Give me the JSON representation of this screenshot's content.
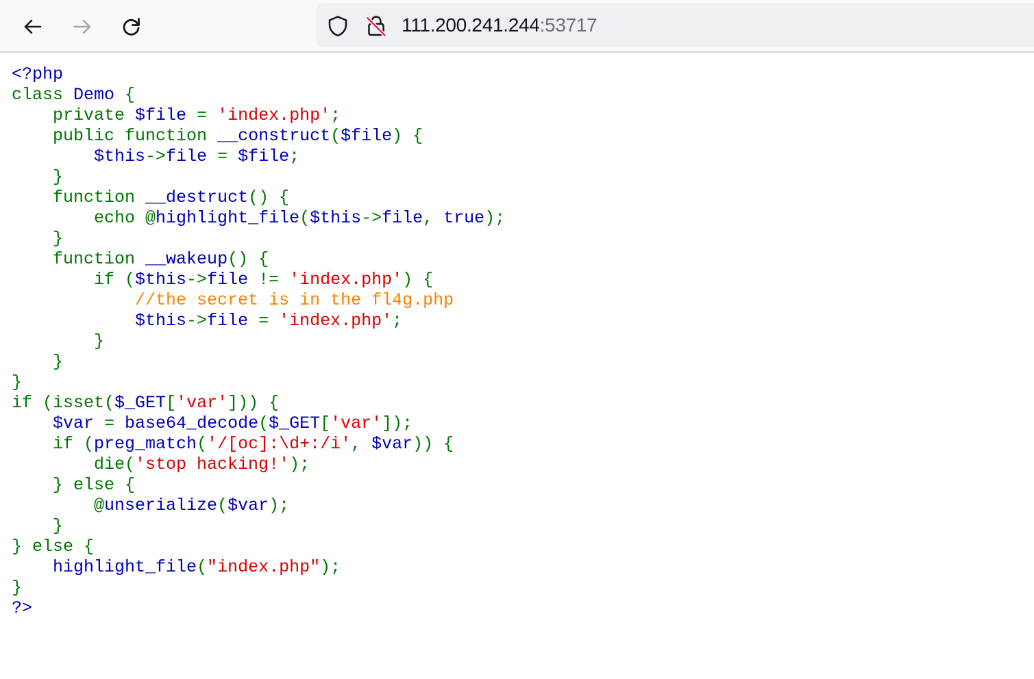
{
  "browser": {
    "back_label": "Back",
    "forward_label": "Forward",
    "reload_label": "Reload",
    "url_host": "111.200.241.244",
    "url_port": ":53717",
    "icons": [
      "arrow-left-icon",
      "arrow-right-icon",
      "reload-icon",
      "shield-icon",
      "insecure-lock-icon"
    ]
  },
  "colors": {
    "html": "#000000",
    "default": "#0000BB",
    "keyword": "#007700",
    "string": "#DD0000",
    "comment": "#FF8000"
  },
  "code_lines": [
    [
      {
        "t": "&lt;?php",
        "c": "default"
      }
    ],
    [
      {
        "t": "class ",
        "c": "keyword"
      },
      {
        "t": "Demo ",
        "c": "default"
      },
      {
        "t": "{",
        "c": "keyword"
      }
    ],
    [
      {
        "t": "    private ",
        "c": "keyword"
      },
      {
        "t": "$file ",
        "c": "default"
      },
      {
        "t": "= ",
        "c": "keyword"
      },
      {
        "t": "'index.php'",
        "c": "string"
      },
      {
        "t": ";",
        "c": "keyword"
      }
    ],
    [
      {
        "t": "    public function ",
        "c": "keyword"
      },
      {
        "t": "__construct",
        "c": "default"
      },
      {
        "t": "(",
        "c": "keyword"
      },
      {
        "t": "$file",
        "c": "default"
      },
      {
        "t": ") {",
        "c": "keyword"
      }
    ],
    [
      {
        "t": "        ",
        "c": "keyword"
      },
      {
        "t": "$this",
        "c": "default"
      },
      {
        "t": "-&gt;",
        "c": "keyword"
      },
      {
        "t": "file ",
        "c": "default"
      },
      {
        "t": "= ",
        "c": "keyword"
      },
      {
        "t": "$file",
        "c": "default"
      },
      {
        "t": ";",
        "c": "keyword"
      }
    ],
    [
      {
        "t": "    }",
        "c": "keyword"
      }
    ],
    [
      {
        "t": "    function ",
        "c": "keyword"
      },
      {
        "t": "__destruct",
        "c": "default"
      },
      {
        "t": "() {",
        "c": "keyword"
      }
    ],
    [
      {
        "t": "        echo @",
        "c": "keyword"
      },
      {
        "t": "highlight_file",
        "c": "default"
      },
      {
        "t": "(",
        "c": "keyword"
      },
      {
        "t": "$this",
        "c": "default"
      },
      {
        "t": "-&gt;",
        "c": "keyword"
      },
      {
        "t": "file",
        "c": "default"
      },
      {
        "t": ", ",
        "c": "keyword"
      },
      {
        "t": "true",
        "c": "default"
      },
      {
        "t": ");",
        "c": "keyword"
      }
    ],
    [
      {
        "t": "    }",
        "c": "keyword"
      }
    ],
    [
      {
        "t": "    function ",
        "c": "keyword"
      },
      {
        "t": "__wakeup",
        "c": "default"
      },
      {
        "t": "() {",
        "c": "keyword"
      }
    ],
    [
      {
        "t": "        if (",
        "c": "keyword"
      },
      {
        "t": "$this",
        "c": "default"
      },
      {
        "t": "-&gt;",
        "c": "keyword"
      },
      {
        "t": "file ",
        "c": "default"
      },
      {
        "t": "!= ",
        "c": "keyword"
      },
      {
        "t": "'index.php'",
        "c": "string"
      },
      {
        "t": ") {",
        "c": "keyword"
      }
    ],
    [
      {
        "t": "            ",
        "c": "keyword"
      },
      {
        "t": "//the secret is in the fl4g.php",
        "c": "comment"
      }
    ],
    [
      {
        "t": "            ",
        "c": "keyword"
      },
      {
        "t": "$this",
        "c": "default"
      },
      {
        "t": "-&gt;",
        "c": "keyword"
      },
      {
        "t": "file ",
        "c": "default"
      },
      {
        "t": "= ",
        "c": "keyword"
      },
      {
        "t": "'index.php'",
        "c": "string"
      },
      {
        "t": ";",
        "c": "keyword"
      }
    ],
    [
      {
        "t": "        }",
        "c": "keyword"
      }
    ],
    [
      {
        "t": "    }",
        "c": "keyword"
      }
    ],
    [
      {
        "t": "}",
        "c": "keyword"
      }
    ],
    [
      {
        "t": "if (isset(",
        "c": "keyword"
      },
      {
        "t": "$_GET",
        "c": "default"
      },
      {
        "t": "[",
        "c": "keyword"
      },
      {
        "t": "'var'",
        "c": "string"
      },
      {
        "t": "])) {",
        "c": "keyword"
      }
    ],
    [
      {
        "t": "    ",
        "c": "keyword"
      },
      {
        "t": "$var ",
        "c": "default"
      },
      {
        "t": "= ",
        "c": "keyword"
      },
      {
        "t": "base64_decode",
        "c": "default"
      },
      {
        "t": "(",
        "c": "keyword"
      },
      {
        "t": "$_GET",
        "c": "default"
      },
      {
        "t": "[",
        "c": "keyword"
      },
      {
        "t": "'var'",
        "c": "string"
      },
      {
        "t": "]);",
        "c": "keyword"
      }
    ],
    [
      {
        "t": "    if (",
        "c": "keyword"
      },
      {
        "t": "preg_match",
        "c": "default"
      },
      {
        "t": "(",
        "c": "keyword"
      },
      {
        "t": "'/[oc]:\\d+:/i'",
        "c": "string"
      },
      {
        "t": ", ",
        "c": "keyword"
      },
      {
        "t": "$var",
        "c": "default"
      },
      {
        "t": ")) {",
        "c": "keyword"
      }
    ],
    [
      {
        "t": "        die(",
        "c": "keyword"
      },
      {
        "t": "'stop hacking!'",
        "c": "string"
      },
      {
        "t": ");",
        "c": "keyword"
      }
    ],
    [
      {
        "t": "    } else {",
        "c": "keyword"
      }
    ],
    [
      {
        "t": "        @",
        "c": "keyword"
      },
      {
        "t": "unserialize",
        "c": "default"
      },
      {
        "t": "(",
        "c": "keyword"
      },
      {
        "t": "$var",
        "c": "default"
      },
      {
        "t": ");",
        "c": "keyword"
      }
    ],
    [
      {
        "t": "    }",
        "c": "keyword"
      }
    ],
    [
      {
        "t": "} else {",
        "c": "keyword"
      }
    ],
    [
      {
        "t": "    ",
        "c": "keyword"
      },
      {
        "t": "highlight_file",
        "c": "default"
      },
      {
        "t": "(",
        "c": "keyword"
      },
      {
        "t": "\"index.php\"",
        "c": "string"
      },
      {
        "t": ");",
        "c": "keyword"
      }
    ],
    [
      {
        "t": "}",
        "c": "keyword"
      }
    ],
    [
      {
        "t": "?&gt;",
        "c": "default"
      }
    ]
  ]
}
